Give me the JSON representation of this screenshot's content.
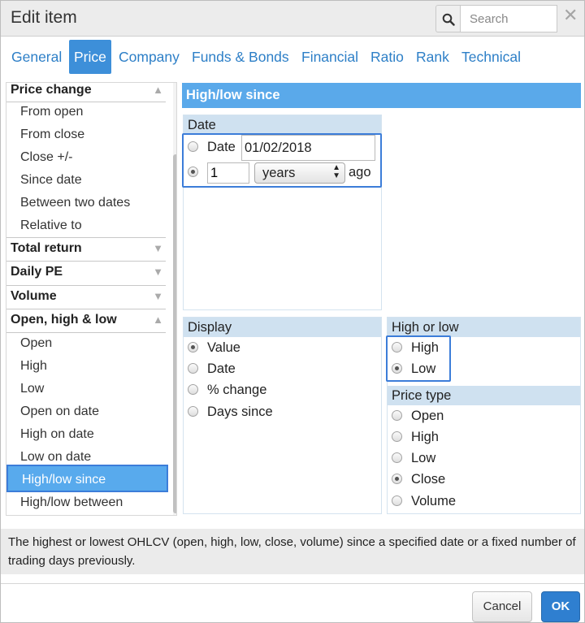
{
  "dialog": {
    "title": "Edit item"
  },
  "search": {
    "placeholder": "Search",
    "value": ""
  },
  "tabs": [
    "General",
    "Price",
    "Company",
    "Funds & Bonds",
    "Financial",
    "Ratio",
    "Rank",
    "Technical"
  ],
  "active_tab": "Price",
  "sidebar": {
    "group_price_change": "Price change",
    "price_change_items": [
      "From open",
      "From close",
      "Close +/-",
      "Since date",
      "Between two dates",
      "Relative to"
    ],
    "group_total_return": "Total return",
    "group_daily_pe": "Daily PE",
    "group_volume": "Volume",
    "group_ohl": "Open, high & low",
    "ohl_items": [
      "Open",
      "High",
      "Low",
      "Open on date",
      "High on date",
      "Low on date",
      "High/low since",
      "High/low between"
    ],
    "selected": "High/low since"
  },
  "section": {
    "header": "High/low since"
  },
  "date_box": {
    "title": "Date",
    "option_date_label": "Date",
    "date_value": "01/02/2018",
    "count_value": "1",
    "unit": "years",
    "ago_label": "ago",
    "selected": "relative"
  },
  "display_box": {
    "title": "Display",
    "options": [
      "Value",
      "Date",
      "% change",
      "Days since"
    ],
    "selected": "Value"
  },
  "highlow_box": {
    "title": "High or low",
    "options": [
      "High",
      "Low"
    ],
    "selected": "Low"
  },
  "pricetype_box": {
    "title": "Price type",
    "options": [
      "Open",
      "High",
      "Low",
      "Close",
      "Volume"
    ],
    "selected": "Close"
  },
  "description": "The highest or lowest OHLCV (open, high, low, close, volume) since a specified date or a fixed number of trading days previously.",
  "buttons": {
    "cancel": "Cancel",
    "ok": "OK"
  },
  "colors": {
    "accent": "#3d8fd9",
    "header": "#5aa9ea",
    "highlight_border": "#3c7dd9",
    "box_header": "#cfe1f0"
  }
}
